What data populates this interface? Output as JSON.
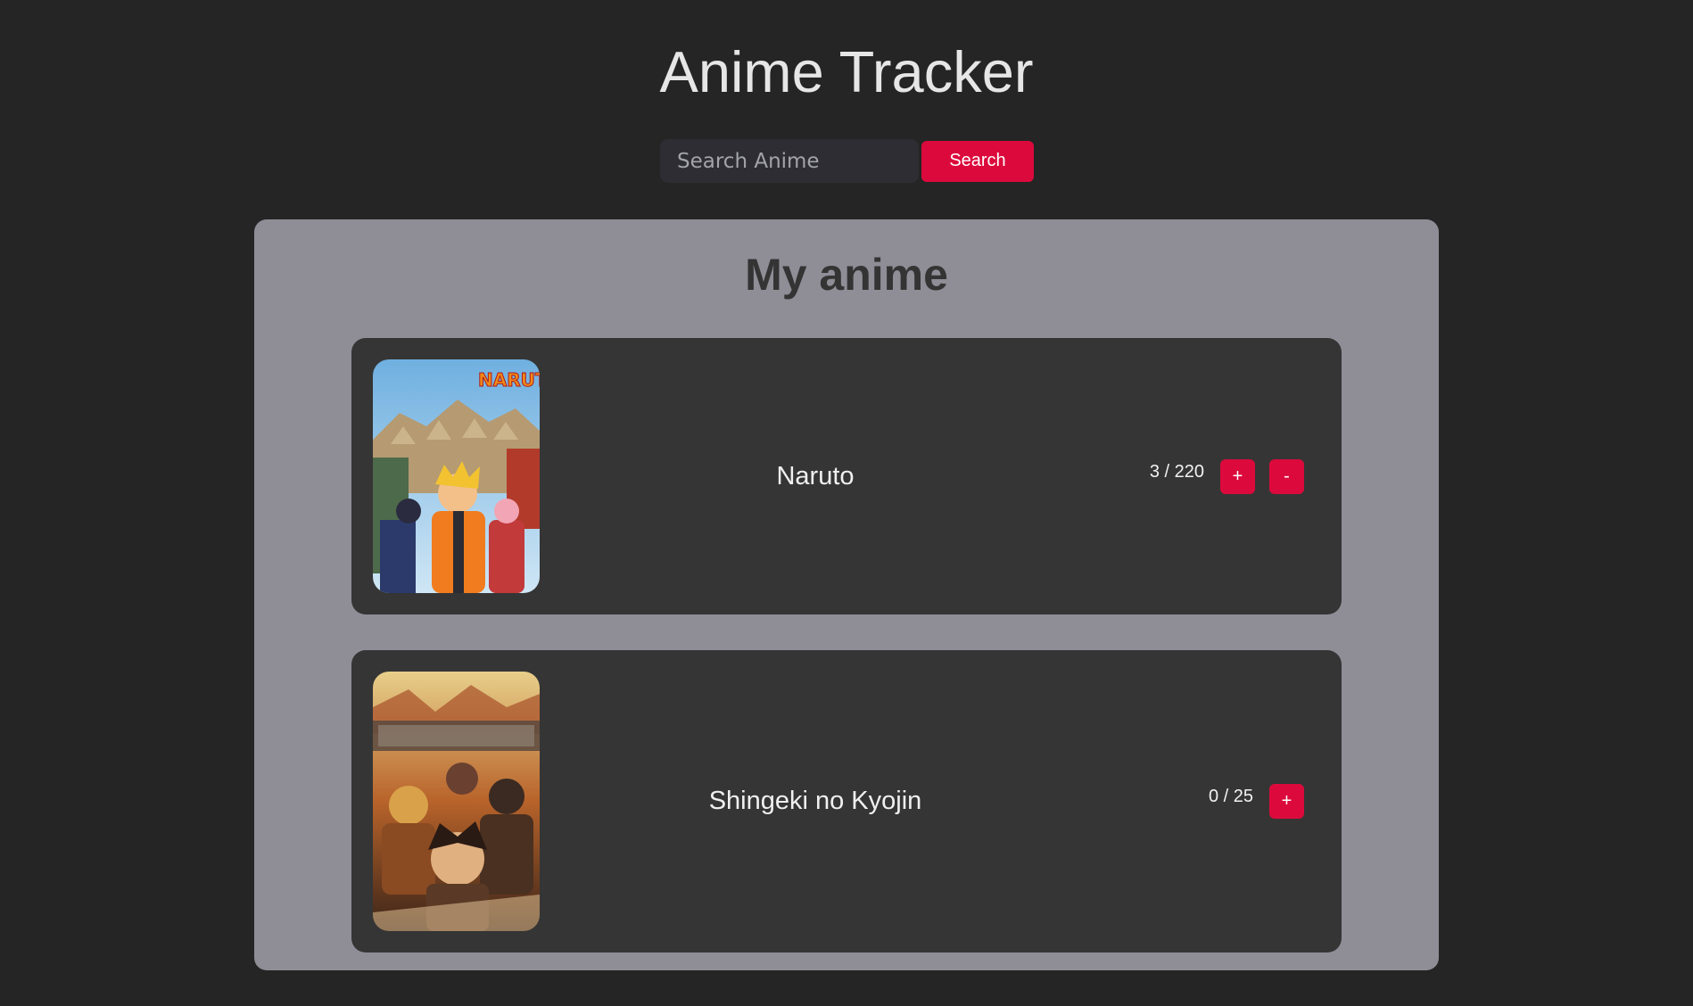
{
  "header": {
    "title": "Anime Tracker"
  },
  "search": {
    "placeholder": "Search Anime",
    "value": "",
    "button_label": "Search"
  },
  "my_anime": {
    "title": "My anime",
    "items": [
      {
        "name": "Naruto",
        "progress": "3 / 220",
        "watched": 3,
        "total": 220,
        "poster": "naruto-poster",
        "increment_label": "+",
        "decrement_label": "-"
      },
      {
        "name": "Shingeki no Kyojin",
        "progress": "0 / 25",
        "watched": 0,
        "total": 25,
        "poster": "shingeki-no-kyojin-poster",
        "increment_label": "+"
      }
    ]
  },
  "colors": {
    "background": "#252525",
    "panel": "#8f8e97",
    "card": "#353535",
    "accent": "#dc0a3c"
  }
}
